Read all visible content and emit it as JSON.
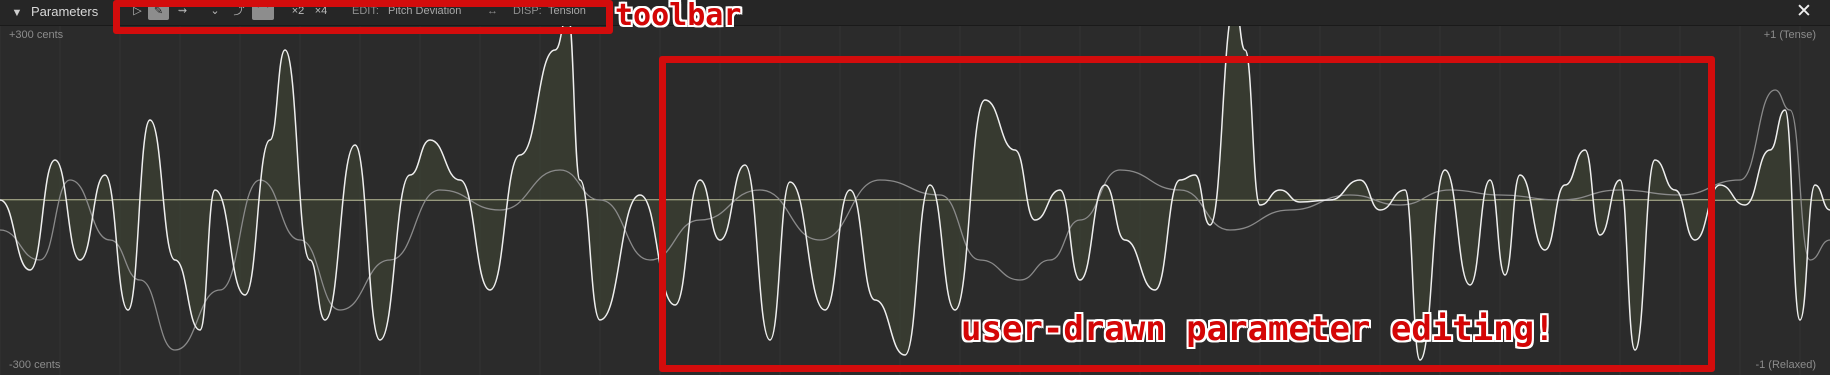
{
  "panel": {
    "title": "Parameters",
    "collapse_icon": "chevron-down-icon",
    "close_glyph": "✕"
  },
  "toolbar": {
    "tools": [
      {
        "name": "select-tool",
        "glyph": "▷",
        "active": false
      },
      {
        "name": "pen-tool",
        "glyph": "✎",
        "active": true
      },
      {
        "name": "vibrato-tool",
        "glyph": "⇝",
        "active": false
      }
    ],
    "shapes": [
      {
        "name": "curve-concave",
        "glyph": "⌄",
        "active": false
      },
      {
        "name": "curve-rise",
        "glyph": "⤴",
        "active": false
      },
      {
        "name": "curve-bell",
        "glyph": "⌒",
        "active": true
      }
    ],
    "multipliers": [
      "×2",
      "×4"
    ],
    "edit_label": "EDIT:",
    "edit_value": "Pitch Deviation",
    "swap_glyph": "↔",
    "disp_label": "DISP:",
    "disp_value": "Tension"
  },
  "axes": {
    "left_top": "+300 cents",
    "left_bottom": "-300 cents",
    "right_top": "+1 (Tense)",
    "right_bottom": "-1 (Relaxed)"
  },
  "annotations": {
    "toolbar_label": "toolbar",
    "editing_label": "user-drawn parameter editing!"
  },
  "colors": {
    "background": "#2b2b2b",
    "grid": "#363636",
    "centerline": "#d8dbb0",
    "primary_curve": "#efefef",
    "secondary_curve": "#8a8a8a",
    "fill": "#3d4233",
    "annotation": "#d30c0c"
  }
}
